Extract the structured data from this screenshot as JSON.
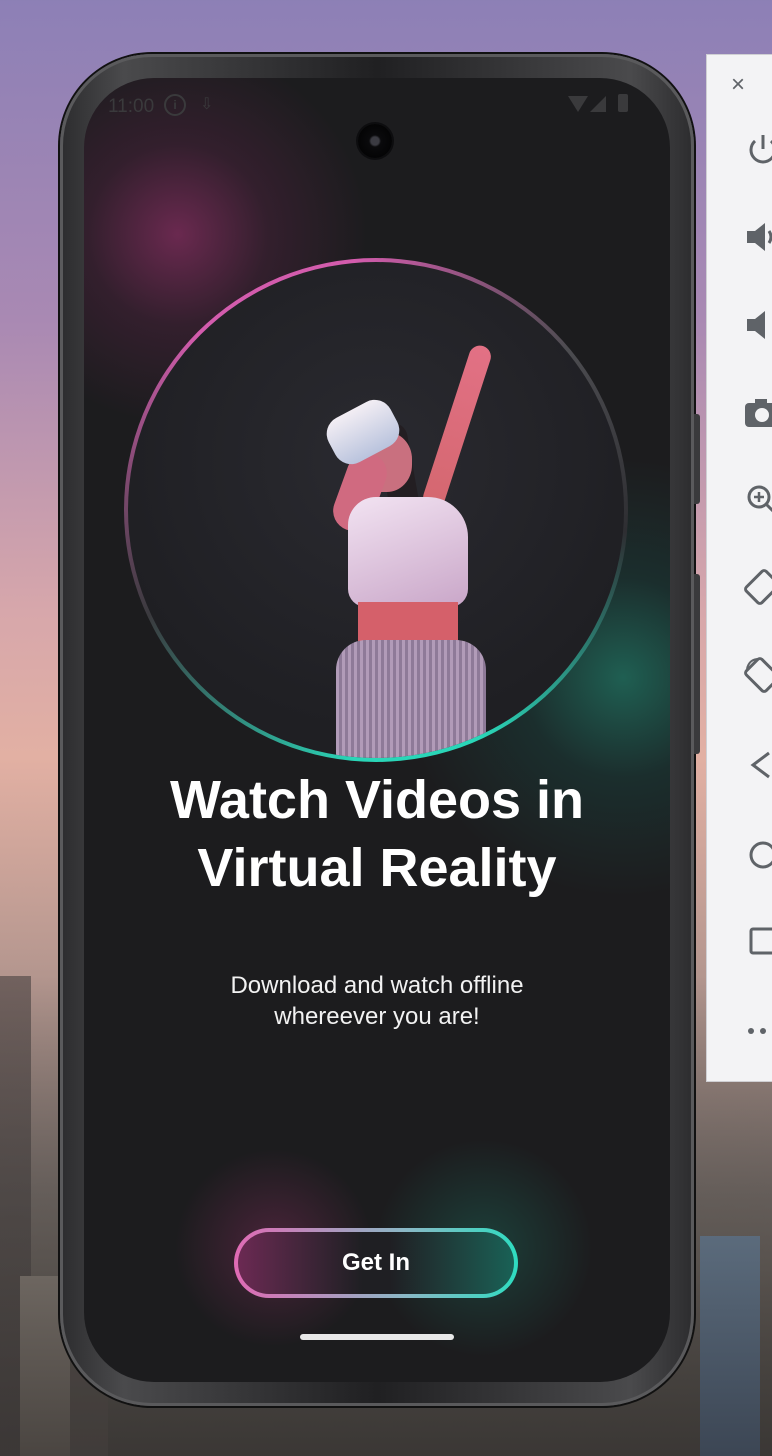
{
  "status_bar": {
    "time": "11:00"
  },
  "onboarding": {
    "title": "Watch Videos in Virtual Reality",
    "subtitle": "Download and watch offline whereever you are!",
    "cta_label": "Get In"
  },
  "colors": {
    "accent_pink": "#d35cad",
    "accent_teal": "#2ad6b8",
    "screen_background": "#1c1c1e"
  },
  "emulator_toolbar": {
    "close_label": "×",
    "items": [
      {
        "icon": "power-icon"
      },
      {
        "icon": "volume-up-icon"
      },
      {
        "icon": "volume-down-icon"
      },
      {
        "icon": "camera-icon"
      },
      {
        "icon": "zoom-icon"
      },
      {
        "icon": "rotate-left-icon"
      },
      {
        "icon": "rotate-right-icon"
      },
      {
        "icon": "back-icon"
      },
      {
        "icon": "home-icon"
      },
      {
        "icon": "overview-icon"
      },
      {
        "icon": "more-icon"
      }
    ]
  }
}
